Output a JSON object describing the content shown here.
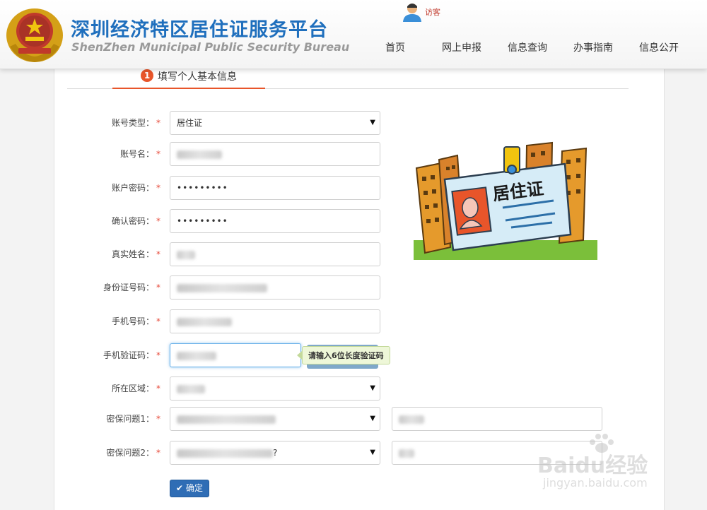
{
  "header": {
    "title": "深圳经济特区居住证服务平台",
    "subtitle": "ShenZhen Municipal Public Security Bureau",
    "user_label": "访客",
    "nav": [
      "首页",
      "网上申报",
      "信息查询",
      "办事指南",
      "信息公开"
    ]
  },
  "step": {
    "number": "1",
    "label": "填写个人基本信息"
  },
  "form": {
    "account_type": {
      "label": "账号类型：",
      "value": "居住证"
    },
    "account_name": {
      "label": "账号名："
    },
    "password": {
      "label": "账户密码：",
      "value": "•••••••••"
    },
    "confirm_password": {
      "label": "确认密码：",
      "value": "•••••••••"
    },
    "real_name": {
      "label": "真实姓名："
    },
    "id_number": {
      "label": "身份证号码："
    },
    "phone": {
      "label": "手机号码："
    },
    "sms_code": {
      "label": "手机验证码：",
      "tooltip": "请输入6位长度验证码"
    },
    "region": {
      "label": "所在区域："
    },
    "security_q1": {
      "label": "密保问题1："
    },
    "security_q2": {
      "label": "密保问题2：",
      "value_suffix": "?"
    },
    "required_mark": "*",
    "submit_label": "确定"
  },
  "illustration": {
    "card_text": "居住证"
  },
  "watermark": {
    "brand": "Baidu经验",
    "url": "jingyan.baidu.com"
  },
  "colors": {
    "title_blue": "#1f6fbd",
    "accent": "#e8552a",
    "submit": "#2f6db5"
  }
}
